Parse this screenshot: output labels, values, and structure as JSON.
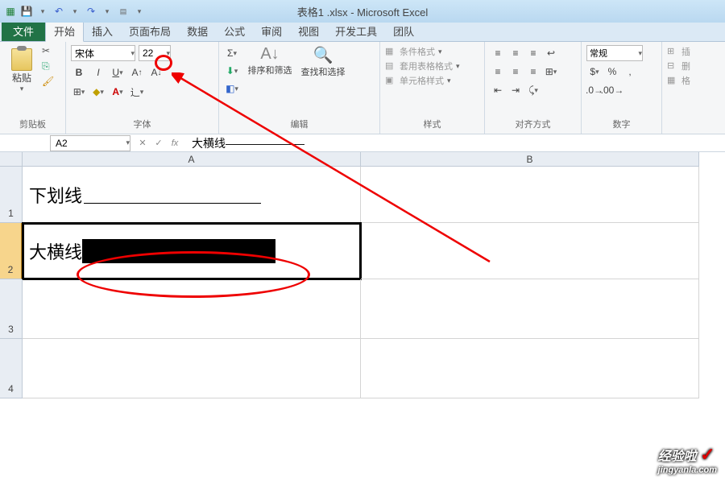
{
  "window": {
    "title": "表格1 .xlsx - Microsoft Excel"
  },
  "tabs": {
    "file": "文件",
    "items": [
      "开始",
      "插入",
      "页面布局",
      "数据",
      "公式",
      "审阅",
      "视图",
      "开发工具",
      "团队"
    ]
  },
  "ribbon": {
    "clipboard": {
      "paste": "粘贴",
      "label": "剪贴板"
    },
    "font": {
      "name": "宋体",
      "size": "22",
      "label": "字体"
    },
    "editing": {
      "sort": "排序和筛选",
      "find": "查找和选择",
      "label": "编辑"
    },
    "cells": {
      "insert": "插入",
      "delete": "删除",
      "format": "格式"
    },
    "styles": {
      "cond": "条件格式",
      "table": "套用表格格式",
      "cell": "单元格样式",
      "label": "样式"
    },
    "align": {
      "label": "对齐方式"
    },
    "number": {
      "general": "常规",
      "label": "数字"
    },
    "more": {
      "insert": "插",
      "delete": "删",
      "format": "格"
    }
  },
  "formula": {
    "cellRef": "A2",
    "content": "大横线———————"
  },
  "cols": [
    "A",
    "B"
  ],
  "rows": [
    "1",
    "2",
    "3",
    "4"
  ],
  "data": {
    "a1_text": "下划线",
    "a2_text": "大横线"
  },
  "watermark": {
    "main": "经验啦",
    "sub": "jingyanla.com"
  }
}
